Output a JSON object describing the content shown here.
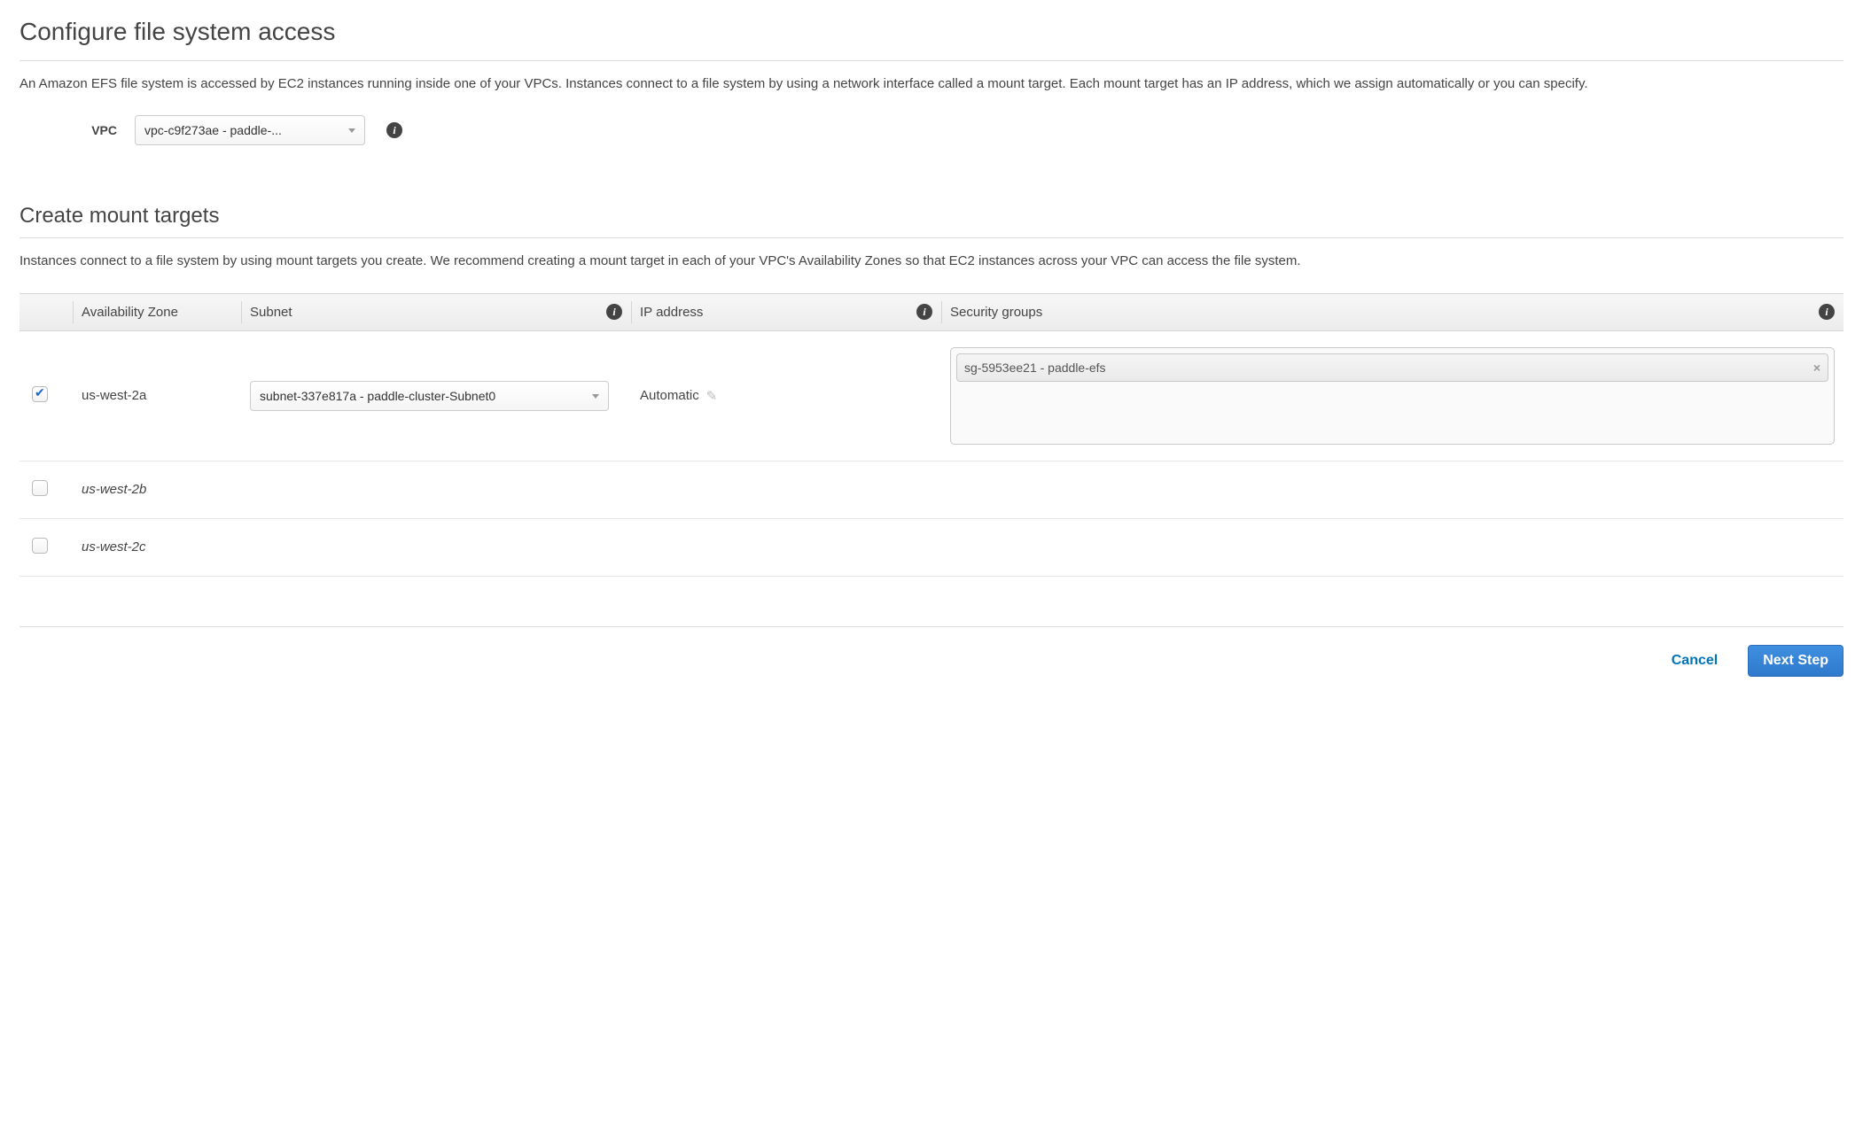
{
  "section1": {
    "title": "Configure file system access",
    "desc": "An Amazon EFS file system is accessed by EC2 instances running inside one of your VPCs. Instances connect to a file system by using a network interface called a mount target. Each mount target has an IP address, which we assign automatically or you can specify."
  },
  "vpc": {
    "label": "VPC",
    "selected": "vpc-c9f273ae - paddle-..."
  },
  "section2": {
    "title": "Create mount targets",
    "desc": "Instances connect to a file system by using mount targets you create. We recommend creating a mount target in each of your VPC's Availability Zones so that EC2 instances across your VPC can access the file system."
  },
  "table": {
    "headers": {
      "az": "Availability Zone",
      "subnet": "Subnet",
      "ip": "IP address",
      "sg": "Security groups"
    },
    "rows": [
      {
        "checked": true,
        "az": "us-west-2a",
        "enabled": true,
        "subnet": "subnet-337e817a - paddle-cluster-Subnet0",
        "ip": "Automatic",
        "sg": "sg-5953ee21 - paddle-efs"
      },
      {
        "checked": false,
        "az": "us-west-2b",
        "enabled": false
      },
      {
        "checked": false,
        "az": "us-west-2c",
        "enabled": false
      }
    ]
  },
  "footer": {
    "cancel": "Cancel",
    "next": "Next Step"
  },
  "glyphs": {
    "info": "i",
    "remove": "×",
    "pencil": "✎"
  }
}
